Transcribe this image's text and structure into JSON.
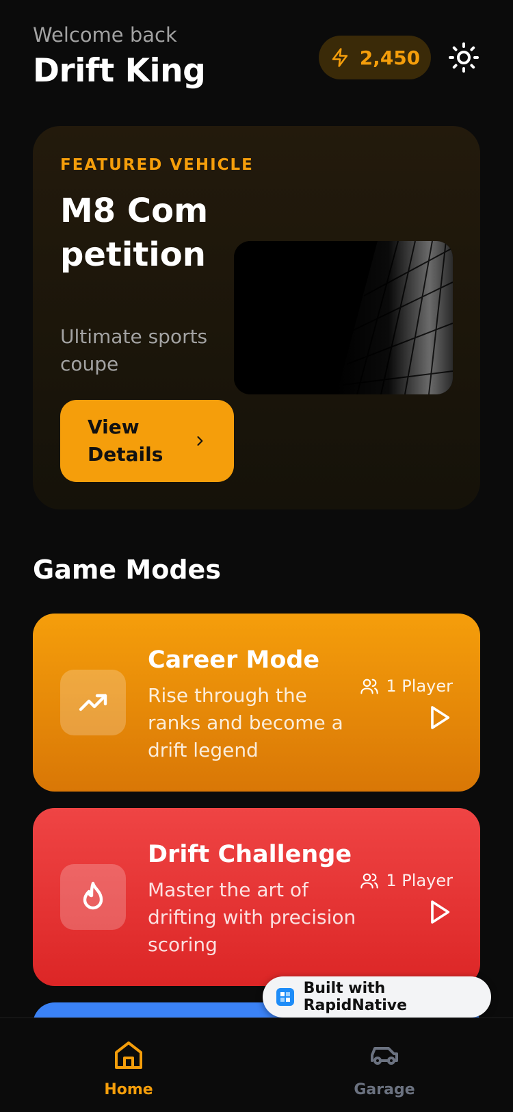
{
  "header": {
    "welcome": "Welcome back",
    "username": "Drift King",
    "points": "2,450"
  },
  "featured": {
    "kicker": "FEATURED VEHICLE",
    "title": "M8 Competition",
    "subtitle": "Ultimate sports coupe",
    "button_label": "View Details"
  },
  "game_modes": {
    "title": "Game Modes",
    "items": [
      {
        "title": "Career Mode",
        "description": "Rise through the ranks and become a drift legend",
        "players": "1 Player",
        "icon": "trending-up-icon"
      },
      {
        "title": "Drift Challenge",
        "description": "Master the art of drifting with precision scoring",
        "players": "1 Player",
        "icon": "flame-icon"
      }
    ]
  },
  "badge": {
    "text": "Built with RapidNative"
  },
  "tabbar": {
    "items": [
      {
        "label": "Home",
        "icon": "home-icon",
        "active": true
      },
      {
        "label": "Garage",
        "icon": "car-icon",
        "active": false
      }
    ]
  },
  "colors": {
    "accent": "#f59e0b",
    "background": "#0b0b0b",
    "career": "#f59e0b",
    "drift": "#ef4444",
    "third": "#3b82f6"
  }
}
